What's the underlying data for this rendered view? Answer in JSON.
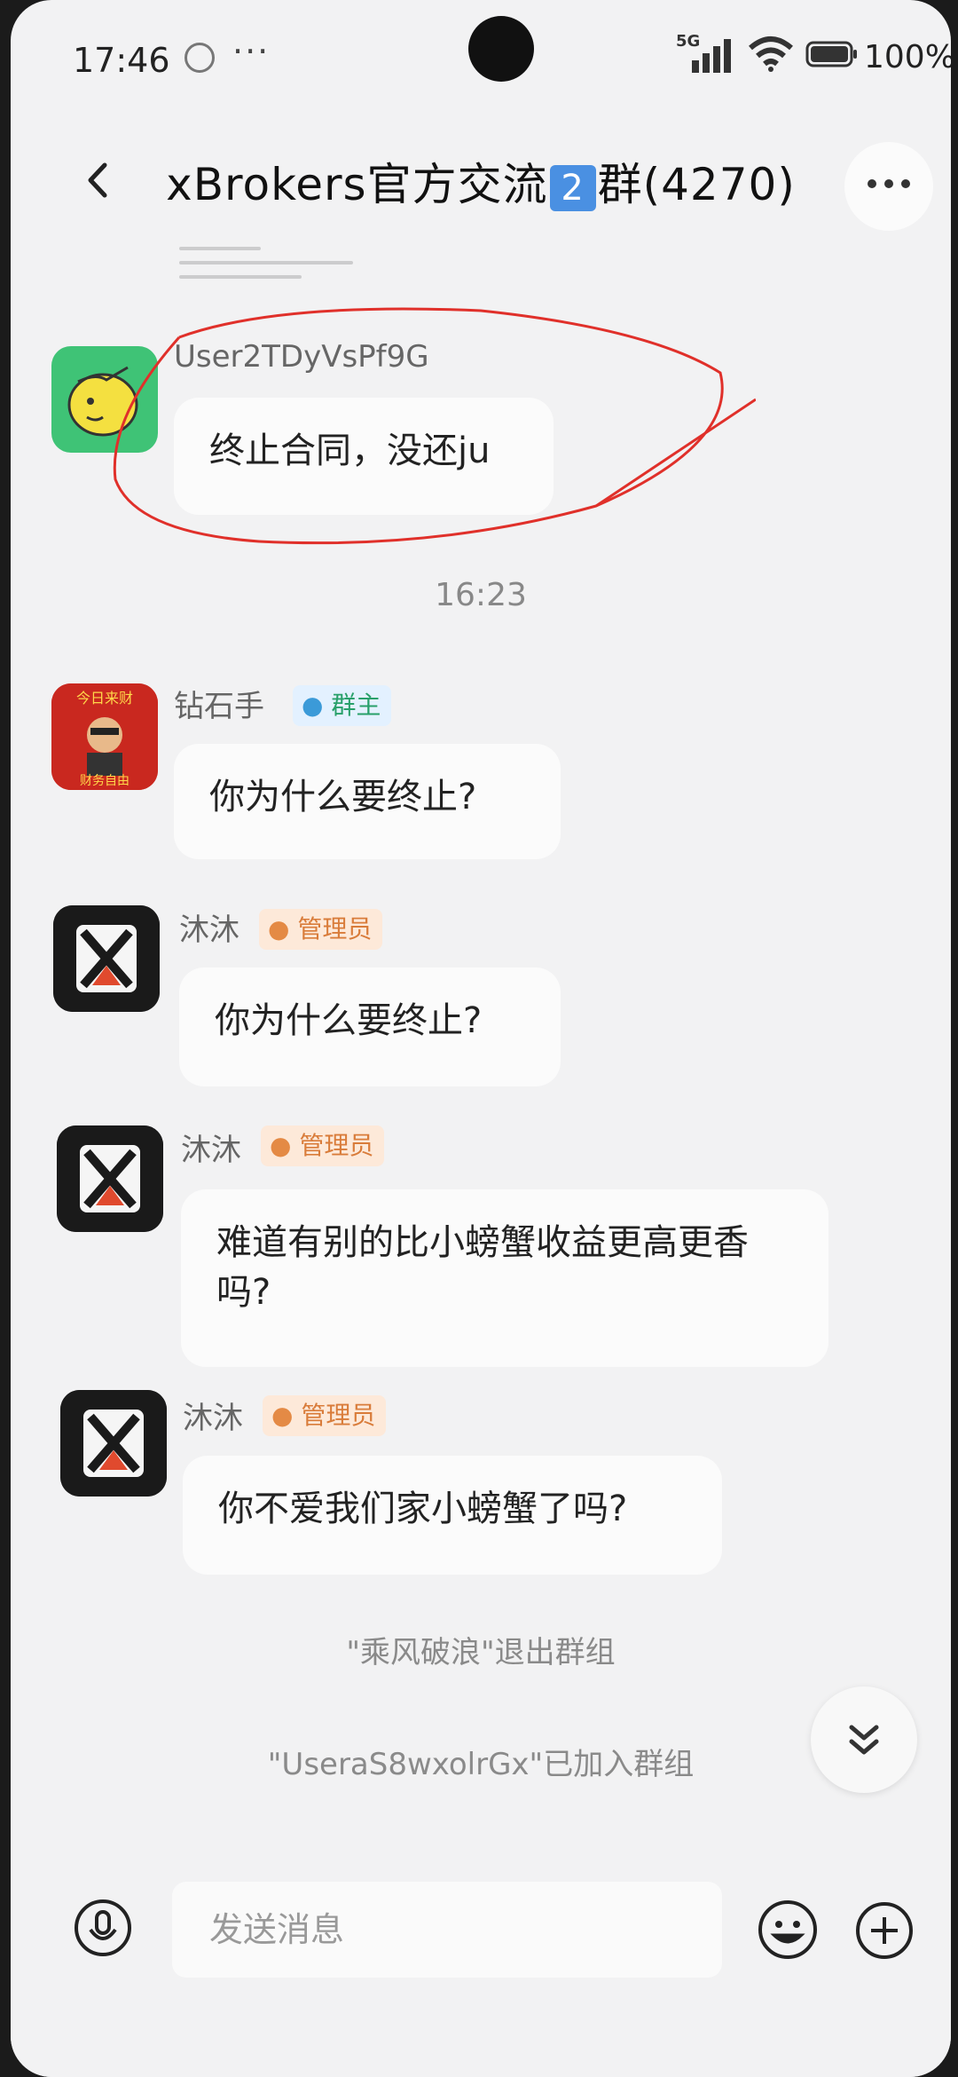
{
  "status_bar": {
    "time": "17:46",
    "dots": "···",
    "network": "5G",
    "battery": "100%"
  },
  "header": {
    "title_prefix": "xBrokers官方交流",
    "title_num": "2",
    "title_suffix": "群(4270)"
  },
  "messages": [
    {
      "sender": "User2TDyVsPf9G",
      "text": "终止合同，没还ju"
    },
    {
      "sender": "钻石手",
      "badge": "群主",
      "text": "你为什么要终止?"
    },
    {
      "sender": "沐沐",
      "badge": "管理员",
      "text": "你为什么要终止?"
    },
    {
      "sender": "沐沐",
      "badge": "管理员",
      "text": "难道有别的比小螃蟹收益更高更香吗?"
    },
    {
      "sender": "沐沐",
      "badge": "管理员",
      "text": "你不爱我们家小螃蟹了吗?"
    }
  ],
  "timestamp": "16:23",
  "system_messages": [
    "\"乘风破浪\"退出群组",
    "\"UseraS8wxolrGx\"已加入群组"
  ],
  "input": {
    "placeholder": "发送消息"
  },
  "colors": {
    "owner_badge": "#28a06a",
    "admin_badge": "#d97c3a",
    "annotation": "#e0302a"
  }
}
